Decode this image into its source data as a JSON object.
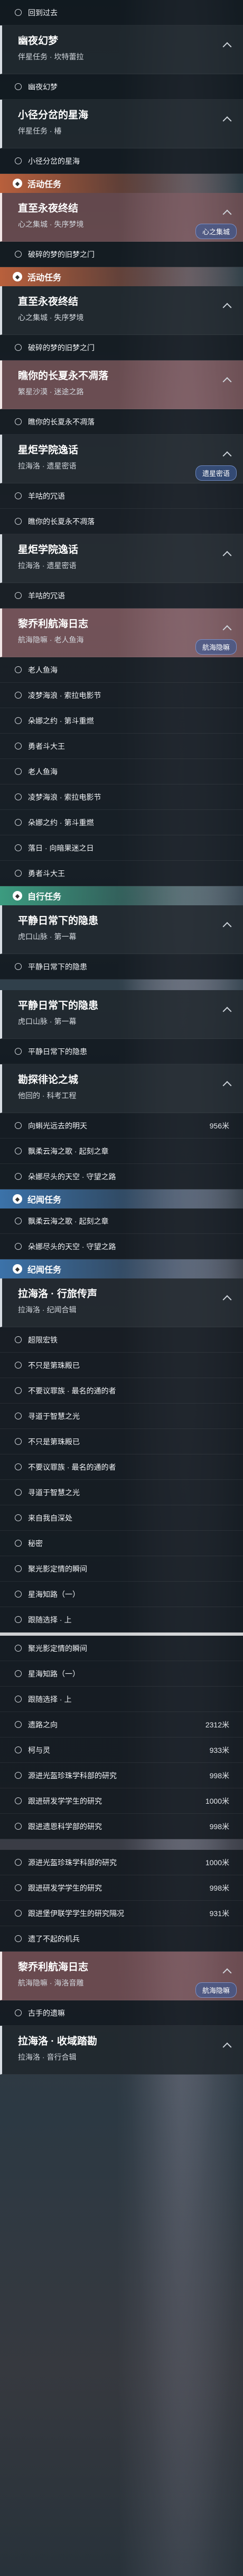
{
  "items": [
    {
      "k": "row",
      "text": "回到过去"
    },
    {
      "k": "card",
      "title": "幽夜幻梦",
      "sub": "伴星任务 · 坎特蕾拉"
    },
    {
      "k": "row",
      "text": "幽夜幻梦"
    },
    {
      "k": "card",
      "title": "小径分岔的星海",
      "sub": "伴星任务 · 椿"
    },
    {
      "k": "row",
      "text": "小径分岔的星海"
    },
    {
      "k": "hdr",
      "style": "red",
      "text": "活动任务"
    },
    {
      "k": "card",
      "hl": true,
      "title": "直至永夜终结",
      "sub": "心之集城 · 失序梦境",
      "btn": "心之集城"
    },
    {
      "k": "row",
      "text": "破碎的梦的旧梦之门"
    },
    {
      "k": "hdr",
      "style": "red",
      "text": "活动任务"
    },
    {
      "k": "card",
      "title": "直至永夜终结",
      "sub": "心之集城 · 失序梦境"
    },
    {
      "k": "row",
      "text": "破碎的梦的旧梦之门"
    },
    {
      "k": "card",
      "hl": true,
      "title": "瞧你的长夏永不凋落",
      "sub": "繁星沙漠 · 迷途之路"
    },
    {
      "k": "row",
      "text": "瞧你的长夏永不凋落"
    },
    {
      "k": "card",
      "title": "星炬学院逸话",
      "sub": "拉海洛 · 遗星密语",
      "btn": "遗星密语"
    },
    {
      "k": "row",
      "text": "羊咕的冗语"
    },
    {
      "k": "row",
      "text": "瞧你的长夏永不凋落"
    },
    {
      "k": "card",
      "title": "星炬学院逸话",
      "sub": "拉海洛 · 遗星密语"
    },
    {
      "k": "row",
      "text": "羊咕的冗语"
    },
    {
      "k": "card",
      "hl": true,
      "title": "黎乔利航海日志",
      "sub": "航海隐嘛 · 老人鱼海",
      "btn": "航海隐嘛"
    },
    {
      "k": "row",
      "text": "老人鱼海"
    },
    {
      "k": "row",
      "text": "凌梦海浪 · 索拉电影节"
    },
    {
      "k": "row",
      "text": "朵娜之约 · 第斗重燃"
    },
    {
      "k": "row",
      "text": "勇者斗大王"
    },
    {
      "k": "row",
      "text": "老人鱼海"
    },
    {
      "k": "row",
      "text": "凌梦海浪 · 索拉电影节"
    },
    {
      "k": "row",
      "text": "朵娜之约 · 第斗重燃"
    },
    {
      "k": "row",
      "text": "落日 · 向暗果迷之日"
    },
    {
      "k": "row",
      "text": "勇者斗大王"
    },
    {
      "k": "hdr",
      "style": "green",
      "text": "自行任务"
    },
    {
      "k": "card",
      "title": "平静日常下的隐患",
      "sub": "虎口山脉 · 第一幕"
    },
    {
      "k": "row",
      "text": "平静日常下的隐患"
    },
    {
      "k": "gap"
    },
    {
      "k": "card",
      "title": "平静日常下的隐患",
      "sub": "虎口山脉 · 第一幕"
    },
    {
      "k": "row",
      "text": "平静日常下的隐患"
    },
    {
      "k": "card",
      "title": "勘探徘论之城",
      "sub": "他回的 · 科考工程"
    },
    {
      "k": "row",
      "text": "向蝌光远去的明天",
      "dist": "956米"
    },
    {
      "k": "row",
      "text": "飘柔云海之歌 · 起刻之章"
    },
    {
      "k": "row",
      "text": "朵娜尽头的天空 · 守望之路"
    },
    {
      "k": "hdr",
      "style": "blue",
      "text": "纪闻任务"
    },
    {
      "k": "row",
      "text": "飘柔云海之歌 · 起刻之章"
    },
    {
      "k": "row",
      "text": "朵娜尽头的天空 · 守望之路"
    },
    {
      "k": "hdr",
      "style": "blue",
      "text": "纪闻任务"
    },
    {
      "k": "card",
      "title": "拉海洛 · 行旅传声",
      "sub": "拉海洛 · 纪闻合辑"
    },
    {
      "k": "row",
      "text": "超限宏铁"
    },
    {
      "k": "row",
      "text": "不只是第珠殿已"
    },
    {
      "k": "row",
      "text": "不要议罪族 · 最名的通的者"
    },
    {
      "k": "row",
      "text": "寻道于智慧之光"
    },
    {
      "k": "row",
      "text": "不只是第珠殿已"
    },
    {
      "k": "row",
      "text": "不要议罪族 · 最名的通的者"
    },
    {
      "k": "row",
      "text": "寻道于智慧之光"
    },
    {
      "k": "row",
      "text": "来自我自深处"
    },
    {
      "k": "row",
      "text": "秘密"
    },
    {
      "k": "row",
      "text": "聚光影定情的瞬间"
    },
    {
      "k": "row",
      "text": "星海知路（一）"
    },
    {
      "k": "row",
      "text": "跟随选择 · 上"
    },
    {
      "k": "bar"
    },
    {
      "k": "row",
      "text": "聚光影定情的瞬间"
    },
    {
      "k": "row",
      "text": "星海知路（一）"
    },
    {
      "k": "row",
      "text": "跟随选择 · 上"
    },
    {
      "k": "row",
      "text": "遗路之向",
      "dist": "2312米"
    },
    {
      "k": "row",
      "text": "柯与灵",
      "dist": "933米"
    },
    {
      "k": "row",
      "text": "源进光盔珍珠学科部的研究",
      "dist": "998米"
    },
    {
      "k": "row",
      "text": "跟进研发学学生的研究",
      "dist": "1000米"
    },
    {
      "k": "row",
      "text": "跟进遗恩科学部的研究",
      "dist": "998米"
    },
    {
      "k": "gap"
    },
    {
      "k": "row",
      "text": "源进光盔珍珠学科部的研究",
      "dist": "1000米"
    },
    {
      "k": "row",
      "text": "跟进研发学学生的研究",
      "dist": "998米"
    },
    {
      "k": "row",
      "text": "跟进堡伊联学学生的研究隔况",
      "dist": "931米"
    },
    {
      "k": "row",
      "text": "遗了不起的机兵"
    },
    {
      "k": "card",
      "hl": true,
      "title": "黎乔利航海日志",
      "sub": "航海隐嘛 · 海洛音雕",
      "btn": "航海隐嘛"
    },
    {
      "k": "row",
      "text": "古手的遗嘛"
    },
    {
      "k": "card",
      "title": "拉海洛 · 收域踏勘",
      "sub": "拉海洛 · 音行合辑"
    }
  ]
}
